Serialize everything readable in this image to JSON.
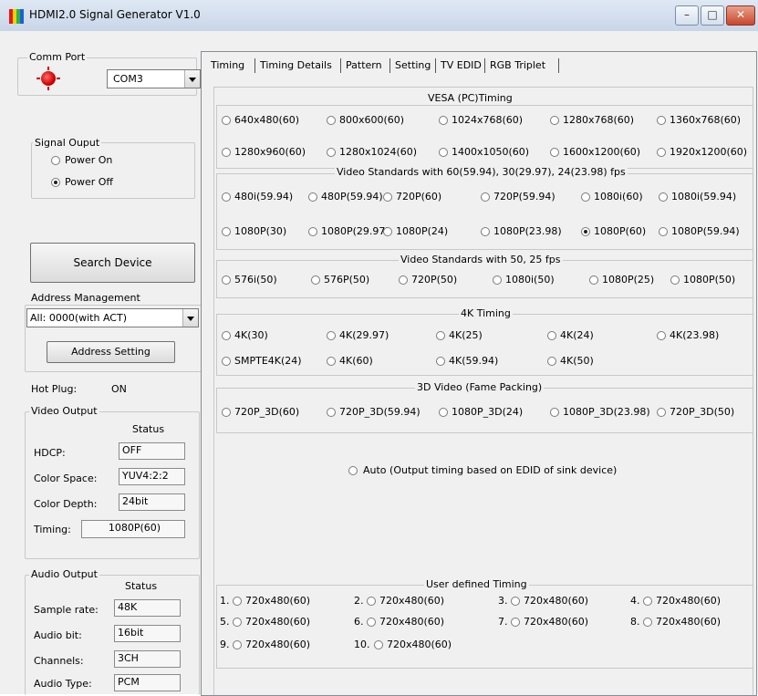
{
  "window": {
    "title": "HDMI2.0 Signal Generator V1.0"
  },
  "comm_port": {
    "label": "Comm Port",
    "value": "COM3"
  },
  "signal_output": {
    "label": "Signal Ouput",
    "options": [
      "Power On",
      "Power Off"
    ],
    "selected": "Power Off"
  },
  "search_device": {
    "label": "Search Device"
  },
  "address_management": {
    "label": "Address Management",
    "value": "All: 0000(with ACT)",
    "button": "Address Setting"
  },
  "hot_plug": {
    "label": "Hot Plug:",
    "value": "ON"
  },
  "video_output": {
    "label": "Video Output",
    "status_header": "Status",
    "fields": [
      {
        "label": "HDCP:",
        "value": "OFF"
      },
      {
        "label": "Color Space:",
        "value": "YUV4:2:2"
      },
      {
        "label": "Color Depth:",
        "value": "24bit"
      },
      {
        "label": "Timing:",
        "value": "1080P(60)"
      }
    ]
  },
  "audio_output": {
    "label": "Audio Output",
    "status_header": "Status",
    "fields": [
      {
        "label": "Sample rate:",
        "value": "48K"
      },
      {
        "label": "Audio bit:",
        "value": "16bit"
      },
      {
        "label": "Channels:",
        "value": "3CH"
      },
      {
        "label": "Audio Type:",
        "value": "PCM"
      }
    ]
  },
  "tabs": [
    "Timing",
    "Timing Details",
    "Pattern",
    "Setting",
    "TV EDID",
    "RGB Triplet"
  ],
  "timing": {
    "vesa": {
      "title": "VESA  (PC)Timing",
      "options": [
        "640x480(60)",
        "800x600(60)",
        "1024x768(60)",
        "1280x768(60)",
        "1360x768(60)",
        "1280x960(60)",
        "1280x1024(60)",
        "1400x1050(60)",
        "1600x1200(60)",
        "1920x1200(60)"
      ]
    },
    "video60": {
      "title": "Video Standards with 60(59.94), 30(29.97), 24(23.98) fps",
      "options": [
        "480i(59.94)",
        "480P(59.94)",
        "720P(60)",
        "720P(59.94)",
        "1080i(60)",
        "1080i(59.94)",
        "1080P(30)",
        "1080P(29.97)",
        "1080P(24)",
        "1080P(23.98)",
        "1080P(60)",
        "1080P(59.94)"
      ],
      "selected": "1080P(60)"
    },
    "video50": {
      "title": "Video Standards with 50, 25 fps",
      "options": [
        "576i(50)",
        "576P(50)",
        "720P(50)",
        "1080i(50)",
        "1080P(25)",
        "1080P(50)"
      ]
    },
    "k4": {
      "title": "4K Timing",
      "options": [
        "4K(30)",
        "4K(29.97)",
        "4K(25)",
        "4K(24)",
        "4K(23.98)",
        "SMPTE4K(24)",
        "4K(60)",
        "4K(59.94)",
        "4K(50)"
      ]
    },
    "video3d": {
      "title": "3D Video (Fame Packing)",
      "options": [
        "720P_3D(60)",
        "720P_3D(59.94)",
        "1080P_3D(24)",
        "1080P_3D(23.98)",
        "720P_3D(50)"
      ]
    },
    "auto": "Auto (Output timing based on EDID of sink device)",
    "user": {
      "title": "User defined Timing",
      "items": [
        {
          "num": "1.",
          "label": "720x480(60)"
        },
        {
          "num": "2.",
          "label": "720x480(60)"
        },
        {
          "num": "3.",
          "label": "720x480(60)"
        },
        {
          "num": "4.",
          "label": "720x480(60)"
        },
        {
          "num": "5.",
          "label": "720x480(60)"
        },
        {
          "num": "6.",
          "label": "720x480(60)"
        },
        {
          "num": "7.",
          "label": "720x480(60)"
        },
        {
          "num": "8.",
          "label": "720x480(60)"
        },
        {
          "num": "9.",
          "label": "720x480(60)"
        },
        {
          "num": "10.",
          "label": "720x480(60)"
        }
      ]
    }
  },
  "colors": {
    "led": "#d00000",
    "window_bg": "#f0f0f0"
  }
}
